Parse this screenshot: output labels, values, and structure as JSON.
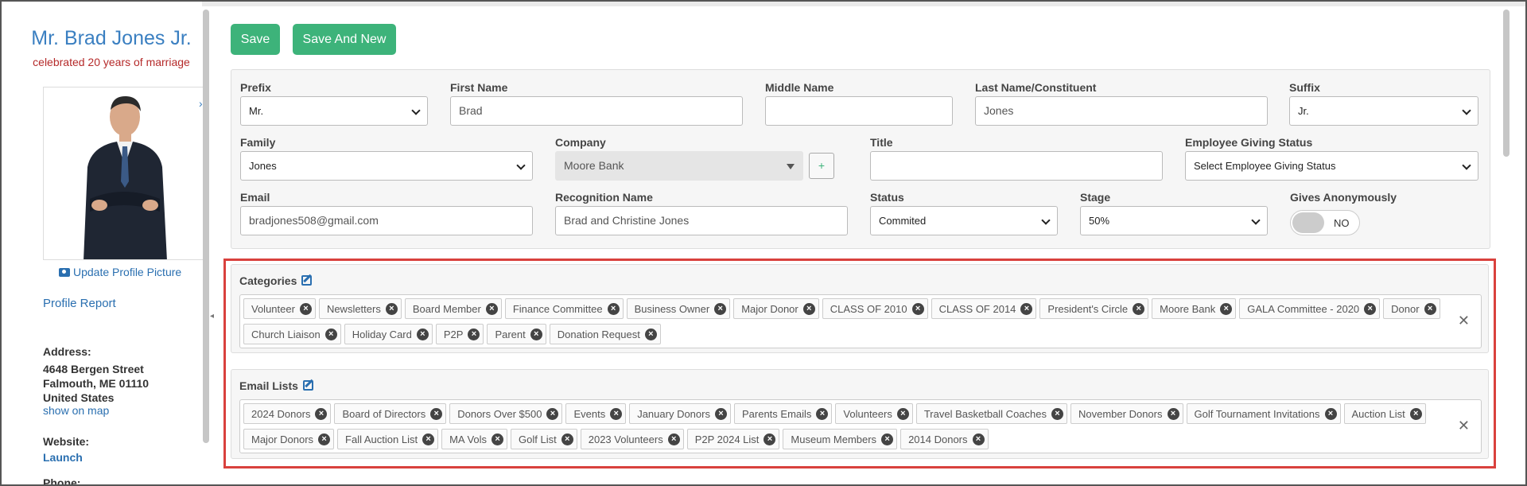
{
  "profile": {
    "name": "Mr. Brad Jones Jr.",
    "tagline": "celebrated 20 years of marriage",
    "update_picture": "Update Profile Picture",
    "profile_report": "Profile Report",
    "address_label": "Address:",
    "address_lines": [
      "4648 Bergen Street",
      "Falmouth, ME 01110",
      "United States"
    ],
    "show_on_map": "show on map",
    "website_label": "Website:",
    "website_link": "Launch",
    "phone_label": "Phone:"
  },
  "toolbar": {
    "save": "Save",
    "save_and_new": "Save And New"
  },
  "form": {
    "prefix": {
      "label": "Prefix",
      "value": "Mr."
    },
    "first_name": {
      "label": "First Name",
      "value": "Brad"
    },
    "middle_name": {
      "label": "Middle Name",
      "value": ""
    },
    "last_name": {
      "label": "Last Name/Constituent",
      "value": "Jones"
    },
    "suffix": {
      "label": "Suffix",
      "value": "Jr."
    },
    "family": {
      "label": "Family",
      "value": "Jones"
    },
    "company": {
      "label": "Company",
      "value": "Moore Bank",
      "add": "+"
    },
    "title": {
      "label": "Title",
      "value": ""
    },
    "employee_giving": {
      "label": "Employee Giving Status",
      "value": "Select Employee Giving Status"
    },
    "email": {
      "label": "Email",
      "value": "bradjones508@gmail.com"
    },
    "recognition": {
      "label": "Recognition Name",
      "value": "Brad and Christine Jones"
    },
    "status": {
      "label": "Status",
      "value": "Commited"
    },
    "stage": {
      "label": "Stage",
      "value": "50%"
    },
    "anonymous": {
      "label": "Gives Anonymously",
      "value": "NO"
    }
  },
  "categories": {
    "title": "Categories",
    "tags": [
      "Volunteer",
      "Newsletters",
      "Board Member",
      "Finance Committee",
      "Business Owner",
      "Major Donor",
      "CLASS OF 2010",
      "CLASS OF 2014",
      "President's Circle",
      "Moore Bank",
      "GALA Committee - 2020",
      "Donor",
      "Church Liaison",
      "Holiday Card",
      "P2P",
      "Parent",
      "Donation Request"
    ]
  },
  "email_lists": {
    "title": "Email Lists",
    "tags": [
      "2024 Donors",
      "Board of Directors",
      "Donors Over $500",
      "Events",
      "January Donors",
      "Parents Emails",
      "Volunteers",
      "Travel Basketball Coaches",
      "November Donors",
      "Golf Tournament Invitations",
      "Auction List",
      "Major Donors",
      "Fall Auction List",
      "MA Vols",
      "Golf List",
      "2023 Volunteers",
      "P2P 2024 List",
      "Museum Members",
      "2014 Donors"
    ]
  },
  "icons": {
    "remove_tag": "×",
    "clear_all": "✕",
    "expand": "›",
    "collapse": "◂"
  }
}
